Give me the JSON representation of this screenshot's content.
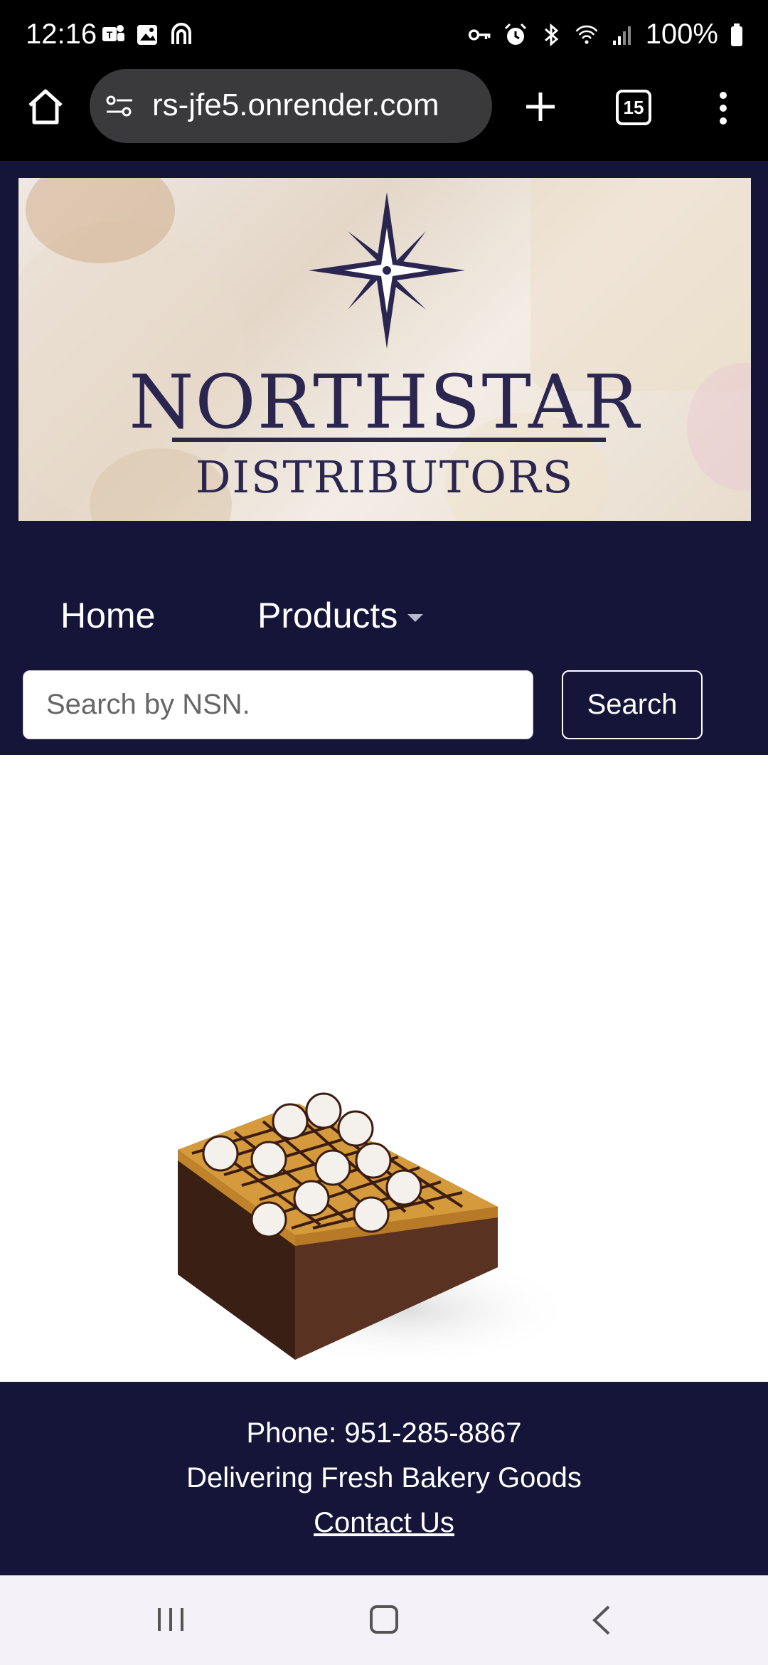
{
  "status_bar": {
    "time": "12:16",
    "battery": "100%",
    "left_icons": [
      "teams-icon",
      "gallery-icon",
      "app-icon"
    ],
    "right_icons": [
      "key-icon",
      "alarm-icon",
      "bluetooth-icon",
      "wifi-icon",
      "signal-icon",
      "battery-icon"
    ]
  },
  "browser": {
    "url": "rs-jfe5.onrender.com",
    "tab_count": "15"
  },
  "site": {
    "brand_name": "NORTHSTAR",
    "brand_sub": "DISTRIBUTORS",
    "nav": {
      "home": "Home",
      "products": "Products"
    },
    "search": {
      "placeholder": "Search by NSN.",
      "button": "Search"
    },
    "product_image": "brownie-cake-image",
    "footer": {
      "phone": "Phone: 951-285-8867",
      "tagline": "Delivering Fresh Bakery Goods",
      "contact": "Contact Us"
    }
  },
  "colors": {
    "header_bg": "#15153a",
    "brand": "#2b2650"
  }
}
